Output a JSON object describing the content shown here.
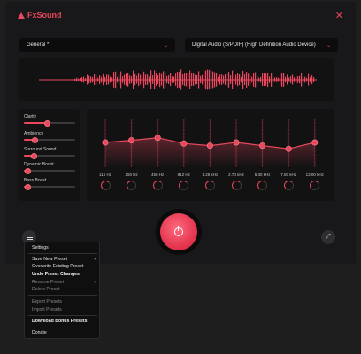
{
  "app": {
    "name": "FxSound"
  },
  "header": {
    "close_glyph": "✕"
  },
  "preset_dropdown": {
    "value": "General *"
  },
  "device_dropdown": {
    "value": "Digital Audio (S/PDIF) (High Definition Audio Device)"
  },
  "effects": [
    {
      "label": "Clarity",
      "level": 0.45
    },
    {
      "label": "Ambience",
      "level": 0.22
    },
    {
      "label": "Surround Sound",
      "level": 0.2
    },
    {
      "label": "Dynamic Boost",
      "level": 0.08
    },
    {
      "label": "Bass Boost",
      "level": 0.08
    }
  ],
  "equalizer": {
    "bands": [
      {
        "freq": "115 Hz",
        "level": 0.0
      },
      {
        "freq": "250 Hz",
        "level": 0.1
      },
      {
        "freq": "450 Hz",
        "level": 0.22
      },
      {
        "freq": "812 Hz",
        "level": -0.05
      },
      {
        "freq": "1.25 kHz",
        "level": -0.15
      },
      {
        "freq": "2.70 kHz",
        "level": 0.0
      },
      {
        "freq": "5.30 kHz",
        "level": -0.15
      },
      {
        "freq": "7.50 kHz",
        "level": -0.3
      },
      {
        "freq": "13.00 kHz",
        "level": 0.0
      }
    ]
  },
  "menu": {
    "settings": "Settings",
    "save_new_preset": "Save New Preset",
    "overwrite_existing_preset": "Overwrite Existing Preset",
    "undo_preset_changes": "Undo Preset Changes",
    "rename_preset": "Rename Preset",
    "delete_preset": "Delete Preset",
    "export_presets": "Export Presets",
    "import_presets": "Import Presets",
    "download_bonus_presets": "Download Bonus Presets",
    "donate": "Donate",
    "submenu_arrow": "›"
  },
  "colors": {
    "accent": "#e8485c",
    "background": "#18181a",
    "panel": "#121213"
  },
  "icons": [
    "fxsound-logo-icon",
    "close-icon",
    "chevron-down-icon",
    "power-icon",
    "hamburger-menu-icon",
    "expand-icon"
  ]
}
